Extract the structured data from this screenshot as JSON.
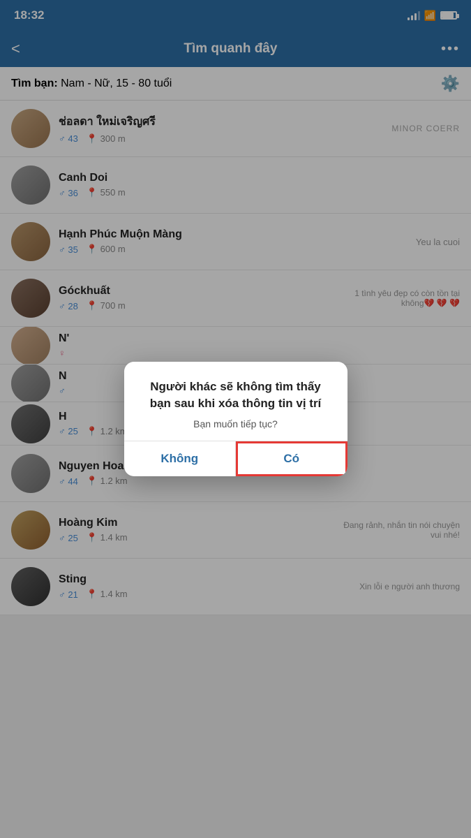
{
  "status": {
    "time": "18:32"
  },
  "header": {
    "title": "Tìm quanh đây",
    "back_label": "<",
    "more_label": "•••"
  },
  "filter": {
    "label": "Tìm bạn:",
    "value": "Nam - Nữ, 15 - 80 tuổi"
  },
  "users": [
    {
      "name": "ช่อลดา ใหม่เจริญศรี",
      "gender": "male",
      "age": "43",
      "distance": "300 m",
      "status": "MINOR  COERR",
      "avatar_class": "avatar-1"
    },
    {
      "name": "Canh Doi",
      "gender": "male",
      "age": "36",
      "distance": "550 m",
      "status": "",
      "avatar_class": "avatar-2"
    },
    {
      "name": "Hạnh Phúc Muộn Màng",
      "gender": "male",
      "age": "35",
      "distance": "600 m",
      "status": "Yeu la cuoi",
      "avatar_class": "avatar-3"
    },
    {
      "name": "Góckhuất",
      "gender": "male",
      "age": "28",
      "distance": "700 m",
      "status": "1 tình yêu đẹp có còn tồn tại không💔 💔 💔",
      "avatar_class": "avatar-4"
    },
    {
      "name": "N'",
      "gender": "female",
      "age": "",
      "distance": "",
      "status": "",
      "avatar_class": "avatar-5",
      "partial": true
    },
    {
      "name": "N",
      "gender": "male",
      "age": "",
      "distance": "",
      "status": "",
      "avatar_class": "avatar-2",
      "partial": true
    },
    {
      "name": "H",
      "gender": "male",
      "age": "25",
      "distance": "1.2 km",
      "status": "",
      "avatar_class": "avatar-6",
      "partial": true
    },
    {
      "name": "Nguyen Hoang Nam",
      "gender": "male",
      "age": "44",
      "distance": "1.2 km",
      "status": "",
      "avatar_class": "avatar-2"
    },
    {
      "name": "Hoàng Kim",
      "gender": "male",
      "age": "25",
      "distance": "1.4 km",
      "status": "Đang rảnh, nhắn tin nói chuyện vui nhé!",
      "avatar_class": "avatar-7"
    },
    {
      "name": "Sting",
      "gender": "male",
      "age": "21",
      "distance": "1.4 km",
      "status": "Xin lỗi e người anh thương",
      "avatar_class": "avatar-8"
    }
  ],
  "dialog": {
    "title": "Người khác sẽ không tìm thấy\nbạn sau khi xóa thông tin vị trí",
    "subtitle": "Bạn muốn tiếp tục?",
    "btn_no": "Không",
    "btn_yes": "Có"
  }
}
